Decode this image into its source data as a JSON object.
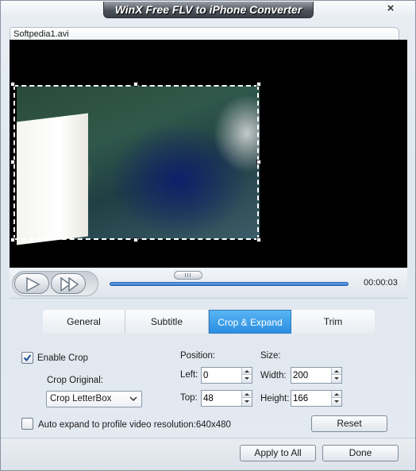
{
  "window": {
    "title": "WinX Free FLV to iPhone Converter",
    "close_glyph": "×"
  },
  "file_tab": {
    "label": "Softpedia1.avi"
  },
  "player": {
    "time": "00:00:03",
    "progress_fraction": 0.33
  },
  "tabs": [
    {
      "label": "General",
      "active": false
    },
    {
      "label": "Subtitle",
      "active": false
    },
    {
      "label": "Crop & Expand",
      "active": true
    },
    {
      "label": "Trim",
      "active": false
    }
  ],
  "crop": {
    "enable_label": "Enable Crop",
    "enabled": true,
    "original_label": "Crop Original:",
    "original_value": "Crop LetterBox",
    "position_label": "Position:",
    "size_label": "Size:",
    "left_label": "Left:",
    "left_value": "0",
    "top_label": "Top:",
    "top_value": "48",
    "width_label": "Width:",
    "width_value": "200",
    "height_label": "Height:",
    "height_value": "166",
    "auto_expand_label": "Auto expand to profile video resolution:640x480",
    "auto_expand": false,
    "reset_label": "Reset"
  },
  "footer": {
    "apply_label": "Apply to All",
    "done_label": "Done"
  },
  "colors": {
    "active_tab": "#2a8fe2",
    "progress": "#2f79d0"
  }
}
